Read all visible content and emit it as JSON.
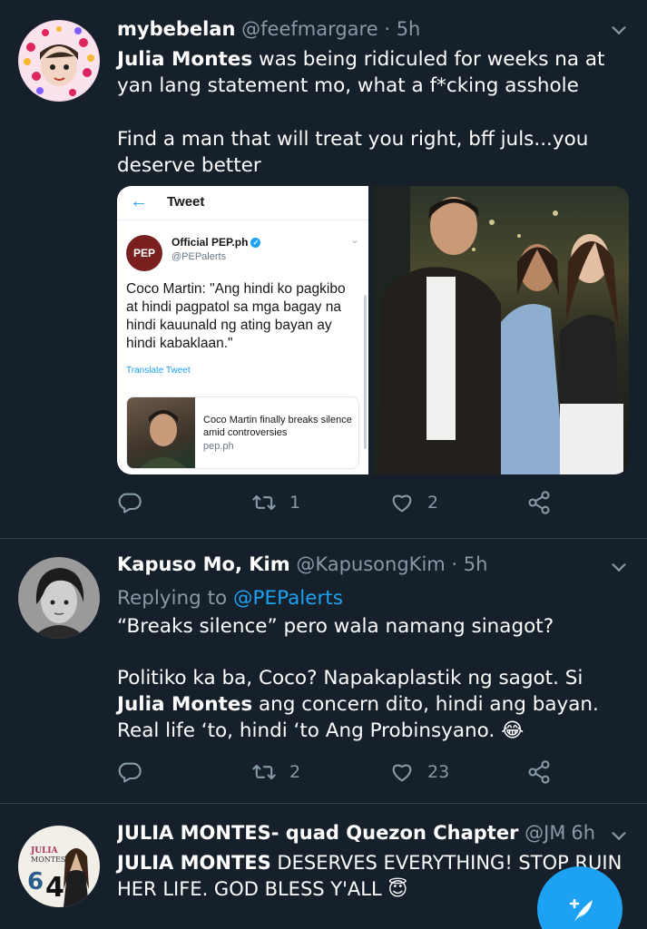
{
  "tweets": [
    {
      "display_name": "mybebelan",
      "handle": "@feefmargare",
      "time": "· 5h",
      "text_bold_1": "Julia Montes",
      "text_1": " was being ridiculed for weeks na at yan lang statement mo, what a f*cking asshole",
      "text_2": "Find a man that will treat you right, bff juls...you deserve better",
      "retweets": "1",
      "likes": "2"
    },
    {
      "display_name": "Kapuso Mo, Kim",
      "handle": "@KapusongKim",
      "time": "· 5h",
      "replying_prefix": "Replying to ",
      "replying_handle": "@PEPalerts",
      "text_1": "“Breaks silence” pero wala namang sinagot?",
      "text_2a": "Politiko ka ba, Coco? Napakaplastik ng sagot. Si ",
      "text_2_bold": "Julia Montes",
      "text_2b": " ang concern dito, hindi ang bayan. Real life ‘to, hindi ‘to Ang Probinsyano. 😂",
      "retweets": "2",
      "likes": "23"
    },
    {
      "display_name": "JULIA MONTES- quad Quezon Chapter",
      "handle": "@JMSq...",
      "time": "· 6h",
      "text_bold": "JULIA MONTES",
      "text": " DESERVES EVERYTHING! STOP RUIN HER LIFE. GOD BLESS Y'ALL 😇"
    }
  ],
  "embedded_screenshot": {
    "back_arrow": "←",
    "title": "Tweet",
    "logo_text": "PEP",
    "account_name": "Official PEP.ph",
    "account_handle": "@PEPalerts",
    "body": "Coco Martin: \"Ang hindi ko pagkibo at hindi pagpatol sa mga bagay na hindi kauunald ng ating bayan ay hindi kabaklaan.\"",
    "translate": "Translate Tweet",
    "link_title": "Coco Martin finally breaks silence amid controversies",
    "link_domain": "pep.ph"
  },
  "icons": {
    "reply": "reply-icon",
    "retweet": "retweet-icon",
    "like": "heart-icon",
    "share": "share-icon",
    "more": "chevron-down-icon",
    "compose": "compose-tweet-icon"
  },
  "colors": {
    "background": "#15202b",
    "secondary_text": "#8899a6",
    "accent": "#1da1f2",
    "divider": "#38444d"
  }
}
